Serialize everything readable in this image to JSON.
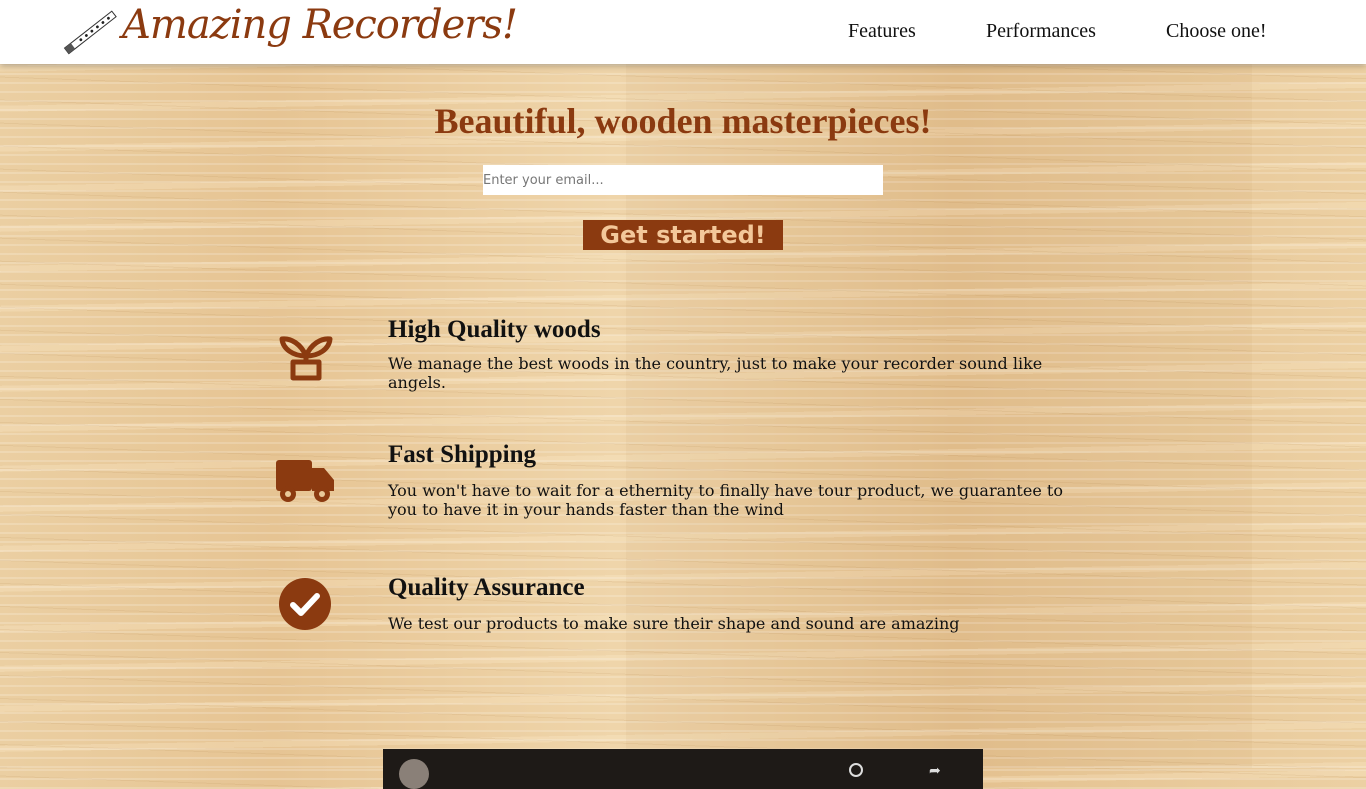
{
  "header": {
    "brand": "Amazing Recorders!",
    "nav": [
      "Features",
      "Performances",
      "Choose one!"
    ]
  },
  "hero": {
    "title": "Beautiful, wooden masterpieces!",
    "email_placeholder": "Enter your email...",
    "cta_label": "Get started!"
  },
  "features": [
    {
      "icon": "plant-pot-icon",
      "title": "High Quality woods",
      "text": "We manage the best woods in the country, just to make your recorder sound like angels."
    },
    {
      "icon": "truck-icon",
      "title": "Fast Shipping",
      "text": "You won't have to wait for a ethernity to finally have tour product, we guarantee to you to have it in your hands faster than the wind"
    },
    {
      "icon": "check-circle-icon",
      "title": "Quality Assurance",
      "text": "We test our products to make sure their shape and sound are amazing"
    }
  ],
  "colors": {
    "accent": "#8b3a10",
    "cta_text": "#f3c79a",
    "header_bg": "#ffffff"
  }
}
